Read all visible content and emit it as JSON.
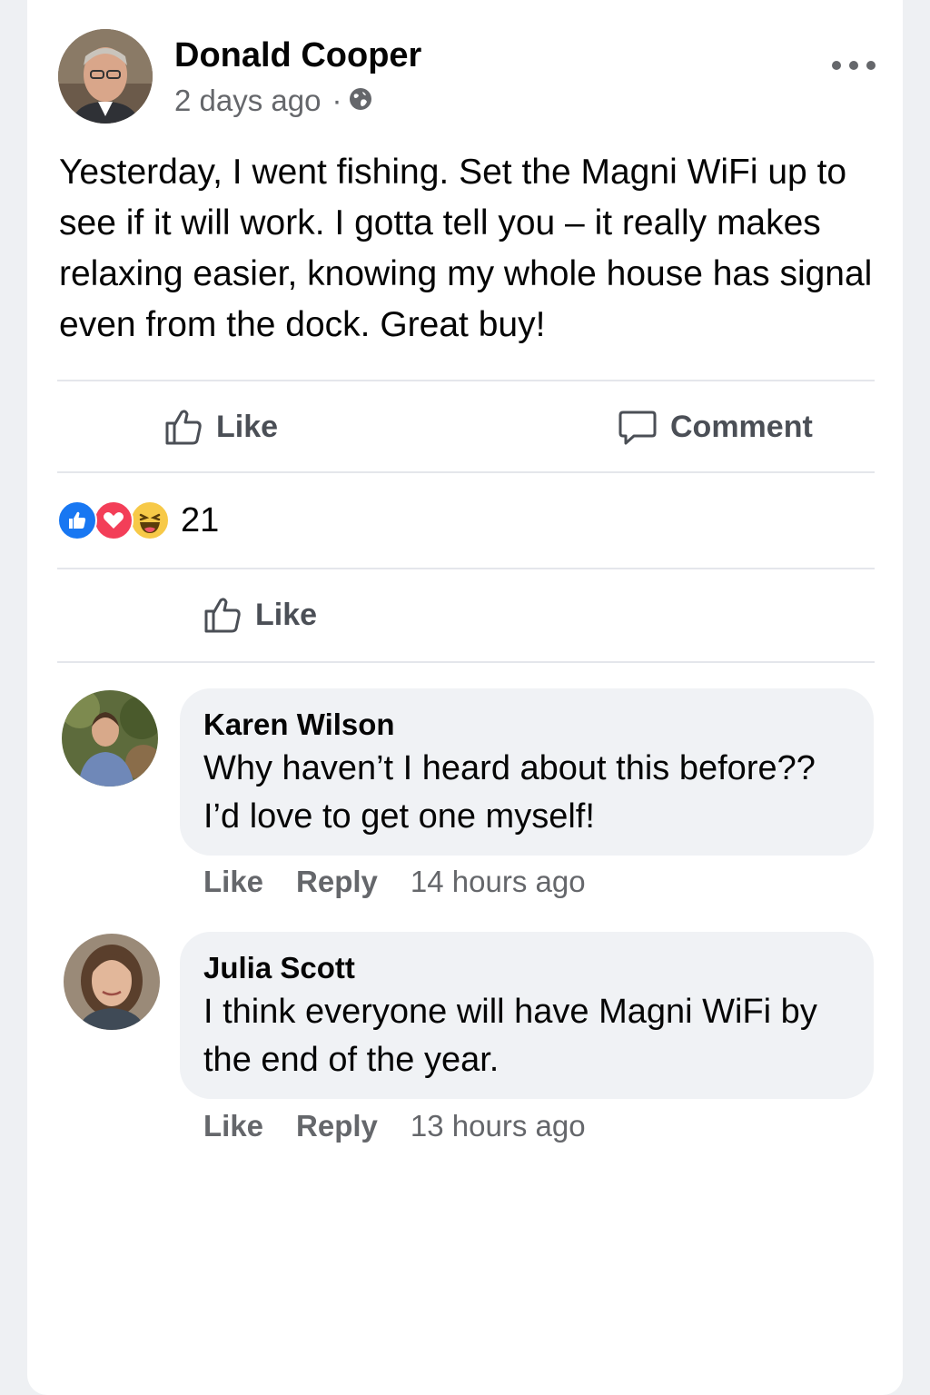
{
  "post": {
    "author_name": "Donald Cooper",
    "time": "2 days ago",
    "separator": "·",
    "privacy_icon": "globe-icon",
    "text": "Yesterday, I went fishing. Set the Magni WiFi up to see if it will work. I gotta tell you – it really makes relaxing easier, knowing my whole house has signal even from the dock. Great buy!"
  },
  "actions": {
    "like_label": "Like",
    "comment_label": "Comment"
  },
  "reactions": {
    "icons": [
      "like-reaction-icon",
      "love-reaction-icon",
      "haha-reaction-icon"
    ],
    "count": "21"
  },
  "secondary_like": {
    "label": "Like"
  },
  "comments": [
    {
      "name": "Karen Wilson",
      "text": "Why haven’t I heard about this before?? I’d love to get one myself!",
      "like_label": "Like",
      "reply_label": "Reply",
      "time": "14 hours ago"
    },
    {
      "name": "Julia Scott",
      "text": "I think everyone will have Magni WiFi by the end of the year.",
      "like_label": "Like",
      "reply_label": "Reply",
      "time": "13 hours ago"
    }
  ],
  "colors": {
    "like_blue": "#1877f2",
    "love_red": "#f33e58",
    "haha_yellow": "#f7b125",
    "secondary_text": "#65676b"
  }
}
